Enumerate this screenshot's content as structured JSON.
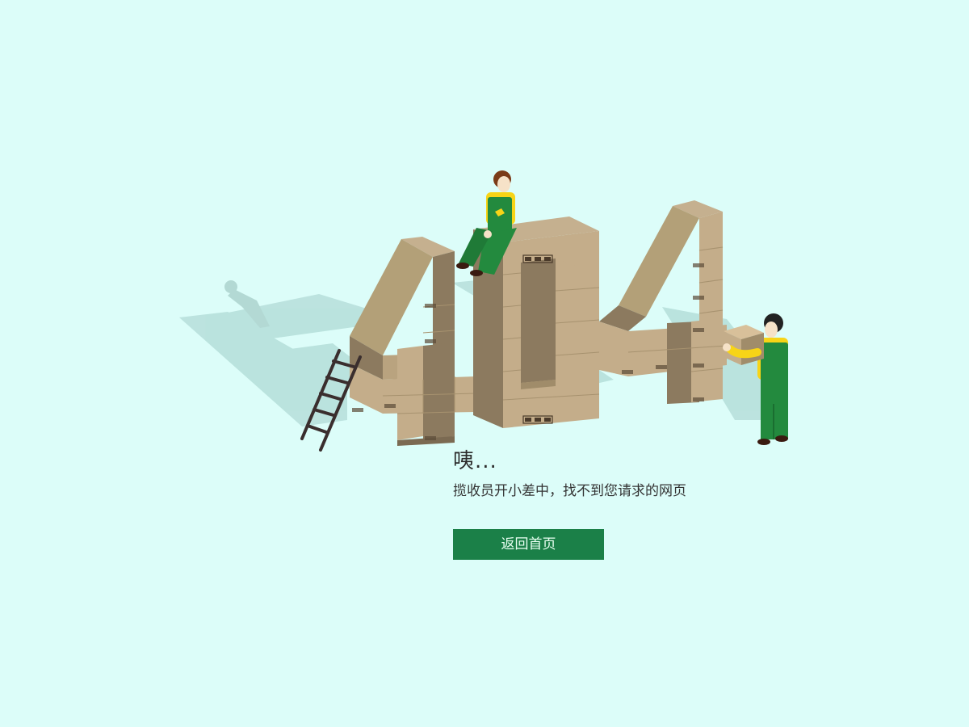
{
  "error_page": {
    "code_text": "404",
    "title": "咦...",
    "subtitle": "揽收员开小差中，找不到您请求的网页",
    "home_button_label": "返回首页"
  },
  "colors": {
    "background": "#dcfdf9",
    "shadow": "#b9e2dd",
    "box_top": "#c5b08f",
    "box_front": "#c4ad8a",
    "box_side": "#8c7a5f",
    "box_line": "#a7926f",
    "button": "#1b8048",
    "worker_overall": "#238a3e",
    "worker_shirt": "#f7d417"
  },
  "icons": [
    "ladder-icon",
    "worker-sitting-icon",
    "worker-carrying-box-icon",
    "cardboard-box-icon"
  ]
}
